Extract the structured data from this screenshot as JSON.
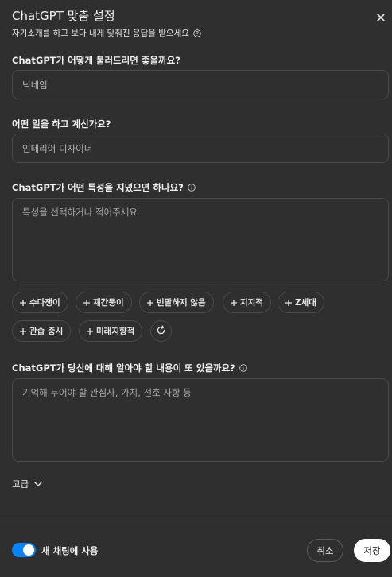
{
  "header": {
    "title": "ChatGPT 맞춤 설정",
    "subtitle": "자기소개를 하고 보다 내게 맞춰진 응답을 받으세요"
  },
  "questions": {
    "nickname": {
      "label": "ChatGPT가 어떻게 불러드리면 좋을까요?",
      "value": "닉네임"
    },
    "occupation": {
      "label": "어떤 일을 하고 계신가요?",
      "value": "인테리어 디자이너"
    },
    "traits": {
      "label": "ChatGPT가 어떤 특성을 지녔으면 하나요?",
      "placeholder": "특성을 선택하거나 적어주세요"
    },
    "about": {
      "label": "ChatGPT가 당신에 대해 알아야 할 내용이 또 있을까요?",
      "placeholder": "기억해 두어야 할 관심사, 가치, 선호 사항 등"
    }
  },
  "chips": [
    "수다쟁이",
    "재간둥이",
    "빈말하지 않음",
    "지지적",
    "Z세대",
    "관습 중시",
    "미래지향적"
  ],
  "advanced": {
    "label": "고급"
  },
  "footer": {
    "toggle_label": "새 채팅에 사용",
    "toggle_on": true,
    "cancel_label": "취소",
    "save_label": "저장"
  },
  "colors": {
    "background": "#2f2f2f",
    "accent": "#0285ff",
    "border": "#4a4a4a"
  },
  "icons": {
    "close": "close-icon",
    "help": "help-circle-icon",
    "plus": "plus-icon",
    "refresh": "refresh-icon",
    "chevron": "chevron-down-icon"
  }
}
